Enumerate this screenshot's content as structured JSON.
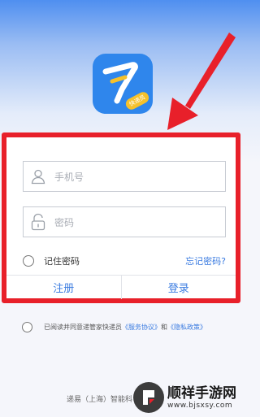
{
  "app": {
    "badge_text": "快递员"
  },
  "login": {
    "phone_placeholder": "手机号",
    "password_placeholder": "密码",
    "remember_label": "记住密码",
    "forgot_label": "忘记密码?",
    "register_label": "注册",
    "login_label": "登录"
  },
  "agreement": {
    "prefix": "已阅读并同意递管家快递员",
    "service_link": "《服务协议》",
    "conjunction": "和",
    "privacy_link": "《隐私政策》"
  },
  "footer": {
    "company": "递易（上海）智能科"
  },
  "watermark": {
    "title": "顺祥手游网",
    "url": "www.bjsxsy.com"
  },
  "colors": {
    "accent": "#3a7be0",
    "highlight_red": "#e8202a",
    "app_icon_blue": "#2f86ec",
    "badge_yellow": "#f6c12b"
  }
}
